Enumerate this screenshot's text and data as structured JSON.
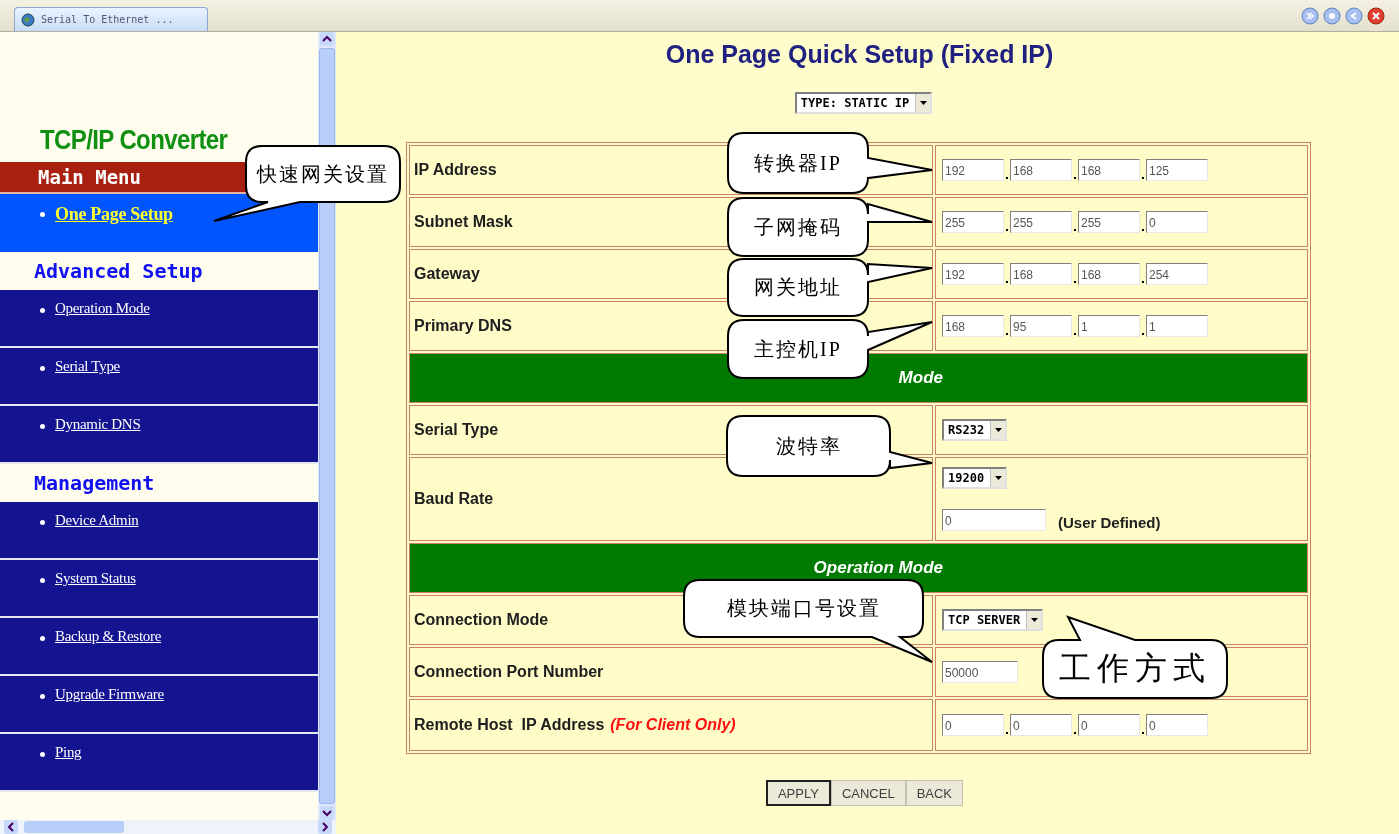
{
  "browser": {
    "tab_title": "Serial To Ethernet ..."
  },
  "sidebar": {
    "brand": "TCP/IP Converter",
    "sections": [
      {
        "title": "Main Menu",
        "kind": "bar",
        "items": [
          {
            "label": "One Page Setup",
            "selected": true
          }
        ]
      },
      {
        "title": "Advanced Setup",
        "kind": "plain",
        "items": [
          {
            "label": "Operation Mode",
            "selected": false
          },
          {
            "label": "Serial Type",
            "selected": false
          },
          {
            "label": "Dynamic DNS",
            "selected": false
          }
        ]
      },
      {
        "title": "Management",
        "kind": "plain",
        "items": [
          {
            "label": "Device Admin",
            "selected": false
          },
          {
            "label": "System Status",
            "selected": false
          },
          {
            "label": "Backup & Restore",
            "selected": false
          },
          {
            "label": "Upgrade Firmware",
            "selected": false
          },
          {
            "label": "Ping",
            "selected": false
          }
        ]
      }
    ]
  },
  "page": {
    "title": "One Page Quick Setup (Fixed IP)",
    "type_select": "TYPE: STATIC IP",
    "rows": [
      {
        "kind": "ip",
        "label": "IP Address",
        "values": [
          "192",
          "168",
          "168",
          "125"
        ]
      },
      {
        "kind": "ip",
        "label": "Subnet Mask",
        "values": [
          "255",
          "255",
          "255",
          "0"
        ]
      },
      {
        "kind": "ip",
        "label": "Gateway",
        "values": [
          "192",
          "168",
          "168",
          "254"
        ]
      },
      {
        "kind": "ip",
        "label": "Primary DNS",
        "values": [
          "168",
          "95",
          "1",
          "1"
        ]
      },
      {
        "kind": "header",
        "label": "Mode"
      },
      {
        "kind": "select",
        "label": "Serial Type",
        "value": "RS232"
      },
      {
        "kind": "baud",
        "label": "Baud Rate",
        "value": "19200",
        "custom": "0",
        "note": "(User Defined)"
      },
      {
        "kind": "header",
        "label": "Operation Mode"
      },
      {
        "kind": "select",
        "label": "Connection Mode",
        "value": "TCP SERVER"
      },
      {
        "kind": "text",
        "label": "Connection Port Number",
        "value": "50000"
      },
      {
        "kind": "ip",
        "label": "Remote Host  IP Address",
        "label_note": "(For Client Only)",
        "values": [
          "0",
          "0",
          "0",
          "0"
        ]
      }
    ],
    "buttons": [
      {
        "label": "APPLY",
        "default": true
      },
      {
        "label": "CANCEL",
        "default": false
      },
      {
        "label": "BACK",
        "default": false
      }
    ]
  },
  "callouts": [
    {
      "text": "快速网关设置"
    },
    {
      "text": "转换器IP"
    },
    {
      "text": "子网掩码"
    },
    {
      "text": "网关地址"
    },
    {
      "text": "主控机IP"
    },
    {
      "text": "波特率"
    },
    {
      "text": "模块端口号设置"
    },
    {
      "text": "工作方式"
    }
  ]
}
